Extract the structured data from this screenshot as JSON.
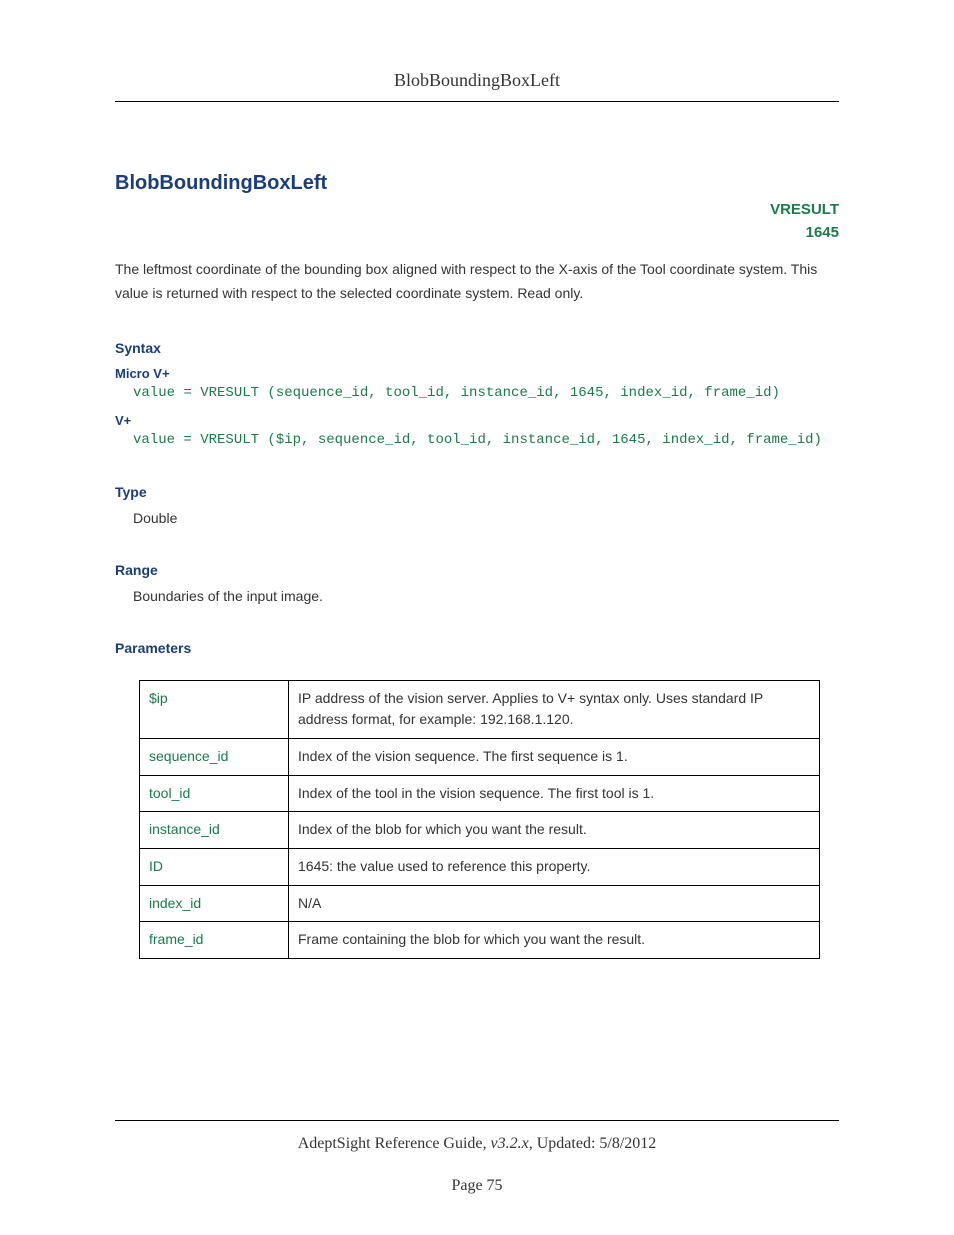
{
  "header": {
    "title": "BlobBoundingBoxLeft"
  },
  "title": "BlobBoundingBoxLeft",
  "meta": {
    "type_label": "VRESULT",
    "code": "1645"
  },
  "description": "The leftmost coordinate of the bounding box aligned with respect to the X-axis of the Tool coordinate system. This value is returned with respect to the selected coordinate system. Read only.",
  "syntax": {
    "heading": "Syntax",
    "micro_label": "Micro V+",
    "micro_code": "value = VRESULT (sequence_id, tool_id, instance_id, 1645, index_id, frame_id)",
    "vplus_label": "V+",
    "vplus_code": "value = VRESULT ($ip, sequence_id, tool_id, instance_id, 1645, index_id, frame_id)"
  },
  "type_section": {
    "heading": "Type",
    "value": "Double"
  },
  "range_section": {
    "heading": "Range",
    "value": "Boundaries of the input image."
  },
  "parameters": {
    "heading": "Parameters",
    "rows": [
      {
        "name": "$ip",
        "desc": "IP address of the vision server. Applies to V+ syntax only. Uses standard IP address format, for example: 192.168.1.120."
      },
      {
        "name": "sequence_id",
        "desc": "Index of the vision sequence. The first sequence is 1."
      },
      {
        "name": "tool_id",
        "desc": "Index of the tool in the vision sequence. The first tool is 1."
      },
      {
        "name": "instance_id",
        "desc": "Index of the blob for which you want the result."
      },
      {
        "name": "ID",
        "desc": "1645: the value used to reference this property."
      },
      {
        "name": "index_id",
        "desc": "N/A"
      },
      {
        "name": "frame_id",
        "desc": "Frame containing the blob for which you want the result."
      }
    ]
  },
  "footer": {
    "guide": "AdeptSight Reference Guide",
    "version": ", v3.2.x",
    "updated": ", Updated: 5/8/2012",
    "page": "Page 75"
  }
}
